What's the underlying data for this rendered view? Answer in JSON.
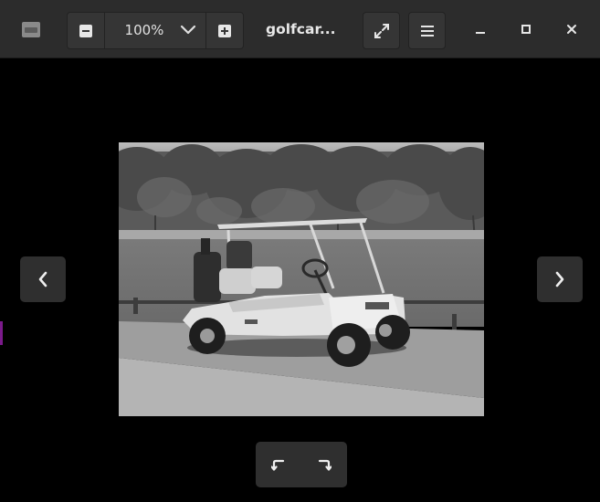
{
  "window": {
    "title": "golfcar...",
    "app_icon": "image-viewer-icon"
  },
  "toolbar": {
    "zoom_out_icon": "minus-square-icon",
    "zoom_value": "100%",
    "zoom_menu_icon": "chevron-down-icon",
    "zoom_in_icon": "plus-square-icon",
    "fullscreen_icon": "fullscreen-expand-icon",
    "menu_icon": "hamburger-menu-icon"
  },
  "window_controls": {
    "minimize_icon": "minimize-icon",
    "maximize_icon": "maximize-icon",
    "close_icon": "close-icon"
  },
  "navigation": {
    "previous_icon": "chevron-left-icon",
    "next_icon": "chevron-right-icon"
  },
  "rotation": {
    "rotate_left_icon": "rotate-left-icon",
    "rotate_right_icon": "rotate-right-icon"
  },
  "colors": {
    "titlebar_bg": "#2c2c2c",
    "button_bg": "#353535",
    "viewer_bg": "#000000",
    "icon_fg": "#e6e6e6"
  }
}
